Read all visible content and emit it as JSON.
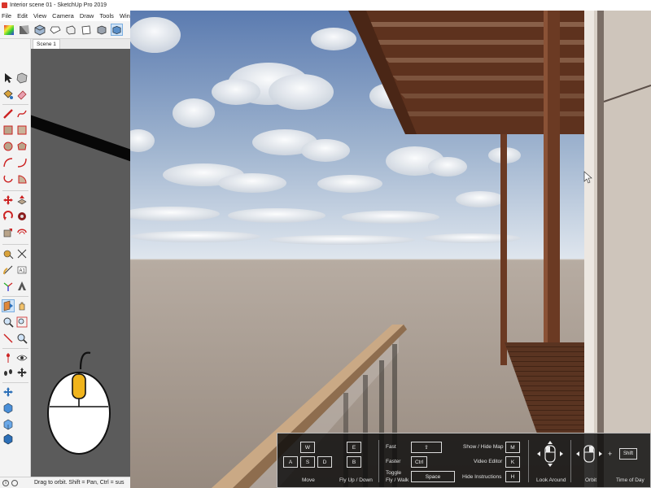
{
  "window": {
    "title": "Interior scene 01 - SketchUp Pro 2019"
  },
  "menu": [
    "File",
    "Edit",
    "View",
    "Camera",
    "Draw",
    "Tools",
    "Windo"
  ],
  "scene_tab": "Scene 1",
  "status_bar": {
    "hint": "Drag to orbit. Shift = Pan, Ctrl = sus"
  },
  "help_panel": {
    "keys": {
      "w": "W",
      "a": "A",
      "s": "S",
      "d": "D",
      "e": "E",
      "b": "B",
      "shift": "⇧",
      "ctrl": "Ctrl",
      "space": "Space",
      "m": "M",
      "k": "K",
      "h": "H",
      "shift_tod": "Shift"
    },
    "labels": {
      "move": "Move",
      "fly": "Fly Up / Down",
      "fast": "Fast",
      "faster": "Faster",
      "toggle_line1": "Toggle",
      "toggle_line2": "Fly / Walk",
      "show_map": "Show / Hide Map",
      "video_editor": "Video Editor",
      "hide_instructions": "Hide Instructions",
      "look_around": "Look Around",
      "orbit": "Orbit",
      "plus": "+",
      "time_of_day": "Time of Day"
    }
  },
  "colors": {
    "sky_top": "#5b7bb0",
    "sky_bottom": "#dfe6ee",
    "ground": "#a89c92",
    "wood": "#6b3a23",
    "wall": "#d7cfc6",
    "mouse_button": "#f0b41c",
    "active_tool": "#cfe3f7"
  }
}
